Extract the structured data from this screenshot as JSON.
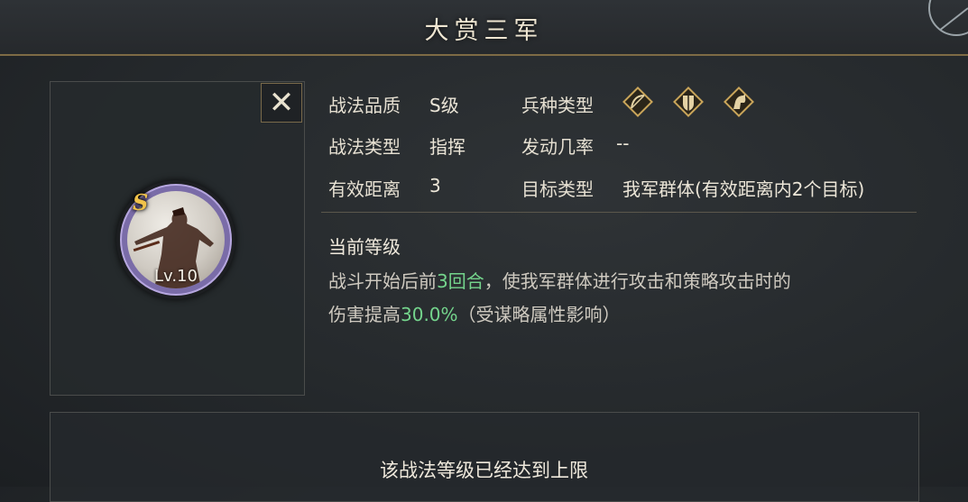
{
  "header": {
    "title": "大赏三军"
  },
  "close_button": {
    "label": "✕",
    "icon": "close-icon"
  },
  "skill": {
    "grade_badge": "S",
    "level_label": "Lv.10"
  },
  "attributes": {
    "quality_key": "战法品质",
    "quality_value": "S级",
    "type_key": "战法类型",
    "type_value": "指挥",
    "range_key": "有效距离",
    "range_value": "3",
    "troop_key": "兵种类型",
    "troop_icons": [
      "bow-archer-icon",
      "shield-infantry-icon",
      "horse-cavalry-icon"
    ],
    "rate_key": "发动几率",
    "rate_value": "--",
    "target_key": "目标类型",
    "target_value": "我军群体(有效距离内2个目标)"
  },
  "current_level": {
    "title": "当前等级",
    "line1_a": "战斗开始后前",
    "line1_hl": "3回合",
    "line1_b": "，使我军群体进行攻击和策略攻击时的",
    "line2_a": "伤害提高",
    "line2_hl": "30.0%",
    "line2_b": "（受谋略属性影响）"
  },
  "footer": {
    "max_level_text": "该战法等级已经达到上限"
  },
  "colors": {
    "accent_gold": "#7e6b45",
    "highlight_green": "#74d48c",
    "ring_purple": "#7a6ca8"
  }
}
